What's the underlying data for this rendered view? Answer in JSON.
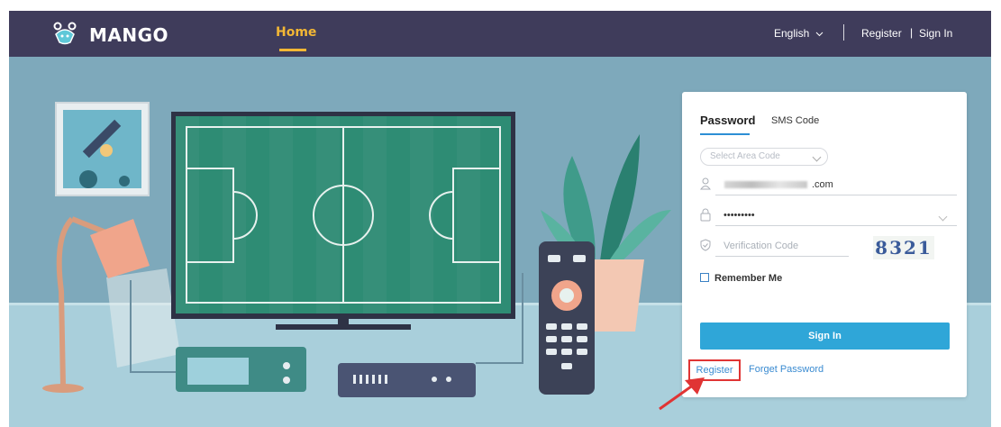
{
  "header": {
    "brand": "MANGO",
    "nav_home": "Home",
    "language": "English",
    "register": "Register",
    "separator": "|",
    "sign_in": "Sign In"
  },
  "login": {
    "tabs": [
      {
        "label": "Password",
        "active": true
      },
      {
        "label": "SMS Code",
        "active": false
      }
    ],
    "area_code": {
      "placeholder": "Select Area Code"
    },
    "email": {
      "value": ".com"
    },
    "password": {
      "value": "•••••••••"
    },
    "verification": {
      "placeholder": "Verification Code",
      "captcha": "8321"
    },
    "remember_label": "Remember Me",
    "sign_in_label": "Sign In",
    "register_link": "Register",
    "forget_link": "Forget Password"
  },
  "colors": {
    "navbar": "#3f3c5b",
    "accent": "#f3b735",
    "button": "#2fa6d8",
    "link": "#3a8bd1",
    "highlight": "#e03434"
  },
  "icons": [
    "mango-logo-icon",
    "chevron-down-icon",
    "user-icon",
    "lock-icon",
    "shield-icon",
    "checkbox-icon",
    "arrow-annotation-icon"
  ]
}
